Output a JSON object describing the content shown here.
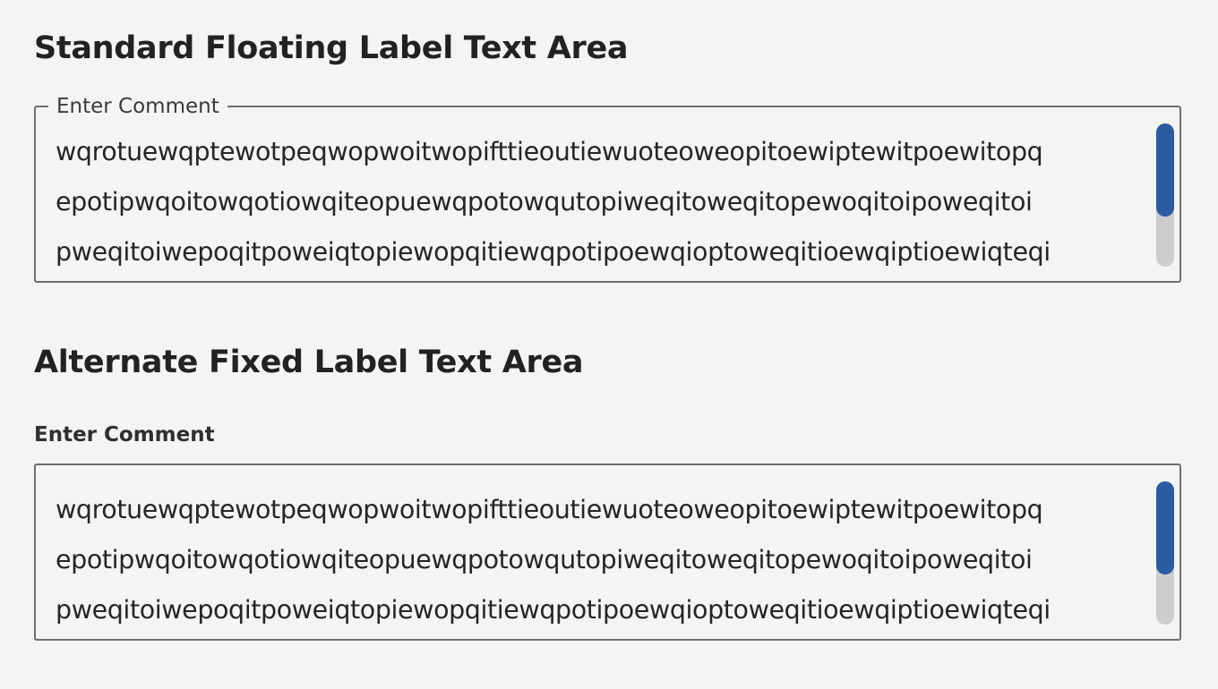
{
  "standard": {
    "title": "Standard Floating Label Text Area",
    "label": "Enter Comment",
    "lines": [
      "wqrotuewqptewotpeqwopwoitwopifttieoutiewuoteoweopitoewiptewitpoewitopq",
      "epotipwqoitowqotiowqiteopuewqpotowqutopiweqitoweqitopewoqitoipoweqitoi",
      "pweqitoiwepoqitpoweiqtopiewopqitiewqpotipoewqioptoweqitioewqiptioewiqteqi"
    ],
    "scroll_position": 0
  },
  "alternate": {
    "title": "Alternate Fixed Label Text Area",
    "label": "Enter Comment",
    "lines": [
      "wqrotuewqptewotpeqwopwoitwopifttieoutiewuoteoweopitoewiptewitpoewitopq",
      "epotipwqoitowqotiowqiteopuewqpotowqutopiweqitoweqitopewoqitoipoweqitoi",
      "pweqitoiwepoqitpoweiqtopiewopqitiewqpotipoewqioptoweqitioewqiptioewiqteqi"
    ],
    "scroll_position": 0
  },
  "colors": {
    "accent": "#2b5ba0",
    "track": "#cdcdcd",
    "border": "#6e6e6e",
    "background": "#f4f4f4"
  }
}
